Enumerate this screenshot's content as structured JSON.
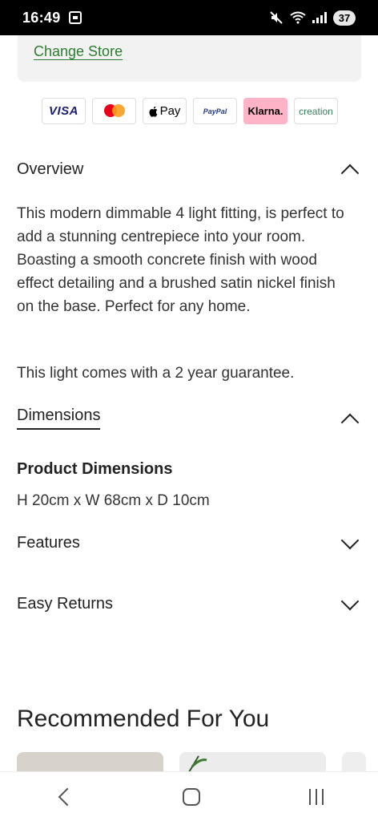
{
  "status_bar": {
    "time": "16:49",
    "battery": "37"
  },
  "store": {
    "change_store_label": "Change Store"
  },
  "payments": {
    "visa": "VISA",
    "apple_pay": "Pay",
    "paypal": "PayPal",
    "klarna": "Klarna.",
    "creation": "creation"
  },
  "overview": {
    "title": "Overview",
    "paragraph1": "This modern dimmable 4 light fitting, is perfect to add a stunning centrepiece into your room. Boasting a smooth concrete finish with wood effect detailing and a brushed satin nickel finish on the base. Perfect for any home.",
    "paragraph2": "This light comes with a 2 year guarantee."
  },
  "dimensions": {
    "title": "Dimensions",
    "heading": "Product Dimensions",
    "value": "H 20cm x W 68cm x D 10cm"
  },
  "features": {
    "title": "Features"
  },
  "easy_returns": {
    "title": "Easy Returns"
  },
  "recommended": {
    "title": "Recommended For You"
  },
  "colors": {
    "link_green": "#2e7d32",
    "store_box_bg": "#f2f2f2",
    "klarna_pink": "#ffb3c7"
  },
  "icons": {
    "overview_toggle": "chevron-up-icon",
    "dimensions_toggle": "chevron-up-icon",
    "features_toggle": "chevron-down-icon",
    "returns_toggle": "chevron-down-icon"
  }
}
